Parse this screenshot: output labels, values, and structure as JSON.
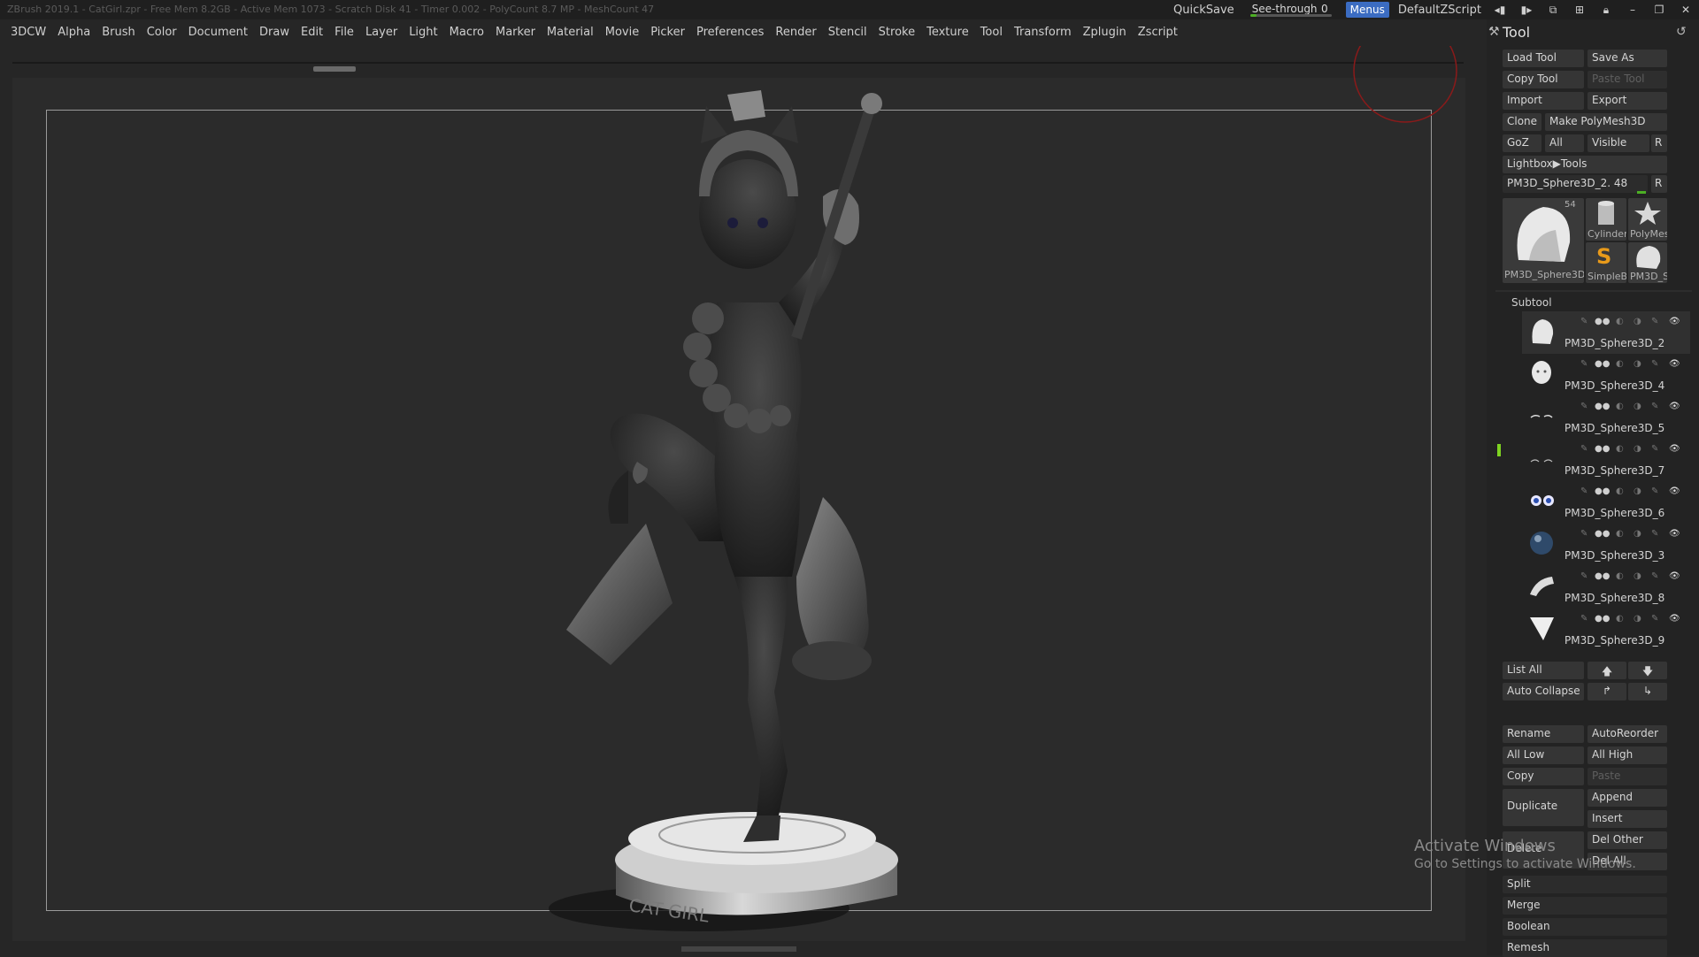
{
  "window": {
    "title_text": "ZBrush 2019.1 - CatGirl.zpr - Free Mem 8.2GB - Active Mem 1073 - Scratch Disk 41 - Timer 0.002 - PolyCount 8.7 MP - MeshCount 47"
  },
  "topbar": {
    "quicksave": "QuickSave",
    "see_through_label": "See-through",
    "see_through_value": "0",
    "see_through_fraction": 0.08,
    "menus": "Menus",
    "default_zscript": "DefaultZScript"
  },
  "menubar": {
    "items": [
      "3DCW",
      "Alpha",
      "Brush",
      "Color",
      "Document",
      "Draw",
      "Edit",
      "File",
      "Layer",
      "Light",
      "Macro",
      "Marker",
      "Material",
      "Movie",
      "Picker",
      "Preferences",
      "Render",
      "Stencil",
      "Stroke",
      "Texture",
      "Tool",
      "Transform",
      "Zplugin",
      "Zscript"
    ]
  },
  "tool_panel": {
    "title": "Tool",
    "load_tool": "Load Tool",
    "save_as": "Save As",
    "copy_tool": "Copy Tool",
    "paste_tool": "Paste Tool",
    "import": "Import",
    "export": "Export",
    "clone": "Clone",
    "make_polymesh": "Make PolyMesh3D",
    "goz": "GoZ",
    "all": "All",
    "visible": "Visible",
    "r": "R",
    "lightbox_tools": "Lightbox▶Tools",
    "current_tool": "PM3D_Sphere3D_2. 48",
    "current_tool_r": "R",
    "thumb_count": "54",
    "thumbnails": [
      {
        "label": "PM3D_Sphere3D",
        "icon": "helmet-icon"
      },
      {
        "label": "Cylinder",
        "icon": "cylinder-icon"
      },
      {
        "label": "PolyMes",
        "icon": "star-icon"
      },
      {
        "label": "SimpleB",
        "icon": "simple-brush-icon"
      },
      {
        "label": "PM3D_S",
        "icon": "helmet-small-icon"
      }
    ]
  },
  "subtool": {
    "title": "Subtool",
    "items": [
      {
        "name": "PM3D_Sphere3D_2",
        "thumb": "helmet-thumb",
        "active": true
      },
      {
        "name": "PM3D_Sphere3D_4",
        "thumb": "face-thumb",
        "active": false
      },
      {
        "name": "PM3D_Sphere3D_5",
        "thumb": "brows-thumb",
        "active": false
      },
      {
        "name": "PM3D_Sphere3D_7",
        "thumb": "lashes-thumb",
        "active": false
      },
      {
        "name": "PM3D_Sphere3D_6",
        "thumb": "eyes-thumb",
        "active": false
      },
      {
        "name": "PM3D_Sphere3D_3",
        "thumb": "sphere-thumb",
        "active": false
      },
      {
        "name": "PM3D_Sphere3D_8",
        "thumb": "band-thumb",
        "active": false
      },
      {
        "name": "PM3D_Sphere3D_9",
        "thumb": "cone-thumb",
        "active": false
      }
    ],
    "list_all": "List All",
    "auto_collapse": "Auto Collapse",
    "rename": "Rename",
    "autoreorder": "AutoReorder",
    "all_low": "All Low",
    "all_high": "All High",
    "copy": "Copy",
    "paste": "Paste",
    "duplicate": "Duplicate",
    "append": "Append",
    "insert": "Insert",
    "delete": "Delete",
    "del_other": "Del Other",
    "del_all": "Del All",
    "split": "Split",
    "merge": "Merge",
    "boolean": "Boolean",
    "remesh": "Remesh"
  },
  "watermark": {
    "line1": "Activate Windows",
    "line2": "Go to Settings to activate Windows."
  },
  "base_text": "CAT GIRL",
  "colors": {
    "accent_blue": "#3b6cc2",
    "active_green": "#4caf24",
    "red_circle": "#8a1a1a"
  }
}
